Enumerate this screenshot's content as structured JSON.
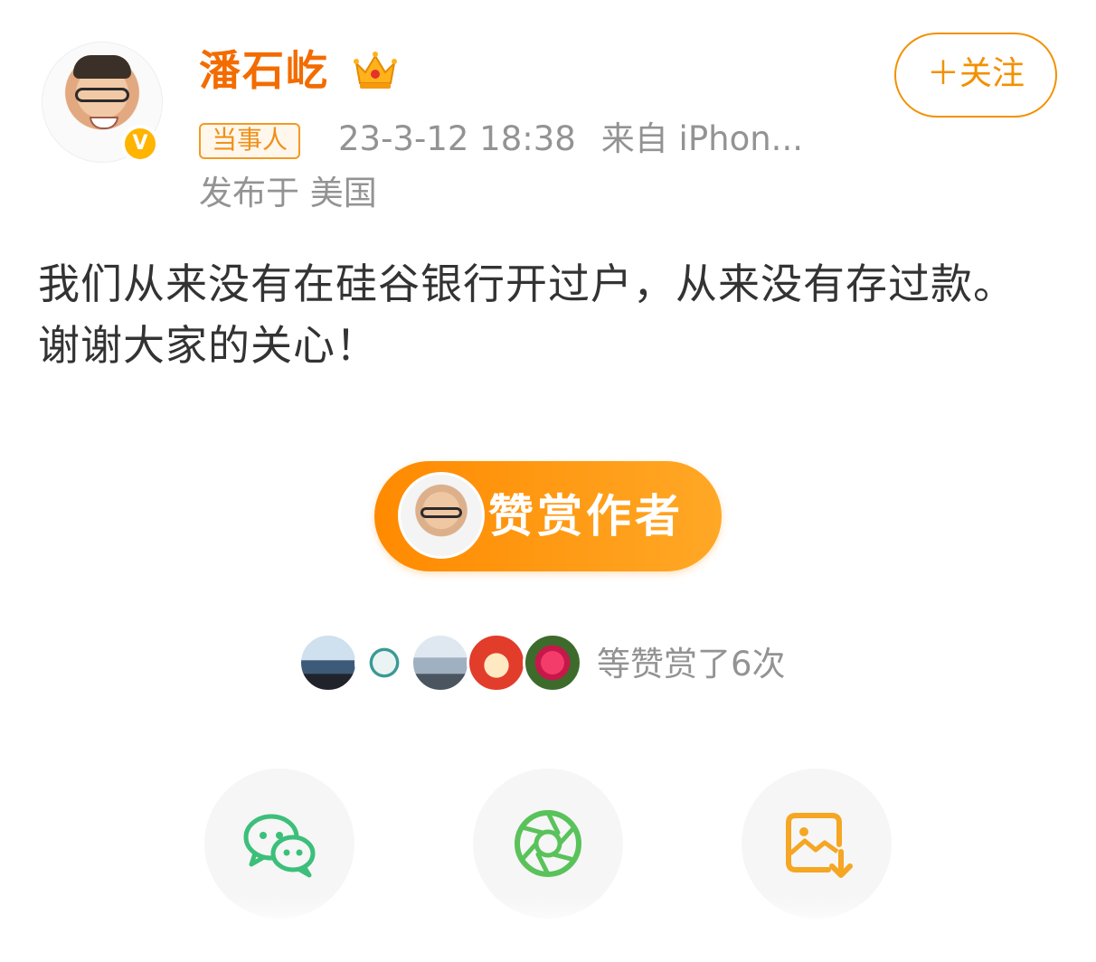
{
  "post": {
    "author": {
      "name": "潘石屹",
      "avatar_icon": "user-avatar-photo",
      "verified_badge": "V",
      "crown_icon": "crown-icon"
    },
    "follow_label": "＋关注",
    "tag": "当事人",
    "timestamp": "23-3-12 18:38",
    "source": "来自 iPhon...",
    "location": "发布于 美国",
    "text": "我们从来没有在硅谷银行开过户，从来没有存过款。谢谢大家的关心！"
  },
  "reward": {
    "button_label": "赞赏作者",
    "summary": "等赞赏了6次",
    "supporters": [
      "supporter-1",
      "supporter-2",
      "supporter-3",
      "supporter-4",
      "supporter-5"
    ]
  },
  "share": {
    "items": [
      {
        "icon": "wechat-icon",
        "color": "#3cbf7a"
      },
      {
        "icon": "moments-icon",
        "color": "#5ac25a"
      },
      {
        "icon": "save-image-icon",
        "color": "#f5a623"
      }
    ]
  },
  "colors": {
    "accent": "#f36c00",
    "follow": "#f39000",
    "reward_gradient_start": "#ff8a00",
    "reward_gradient_end": "#ffa826",
    "meta_gray": "#939393"
  }
}
